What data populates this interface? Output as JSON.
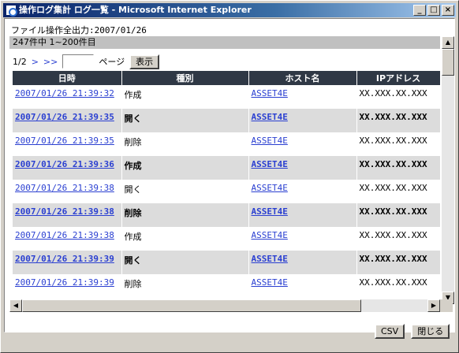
{
  "window": {
    "title": "操作ログ集計 ログ一覧 - Microsoft Internet Explorer",
    "buttons": [
      "_",
      "□",
      "×"
    ]
  },
  "header": {
    "text": "ファイル操作全出力:2007/01/26"
  },
  "count_bar": {
    "text": "247件中 1~200件目"
  },
  "pager": {
    "page": "1/2",
    "next": ">",
    "last": ">>",
    "page_input": "",
    "page_label": "ページ",
    "show_button": "表示"
  },
  "table": {
    "columns": [
      "日時",
      "種別",
      "ホスト名",
      "IPアドレス"
    ],
    "rows": [
      {
        "time": "2007/01/26 21:39:32",
        "type": "作成",
        "host": "ASSET4E",
        "ip": "XX.XXX.XX.XXX"
      },
      {
        "time": "2007/01/26 21:39:35",
        "type": "開く",
        "host": "ASSET4E",
        "ip": "XX.XXX.XX.XXX"
      },
      {
        "time": "2007/01/26 21:39:35",
        "type": "削除",
        "host": "ASSET4E",
        "ip": "XX.XXX.XX.XXX"
      },
      {
        "time": "2007/01/26 21:39:36",
        "type": "作成",
        "host": "ASSET4E",
        "ip": "XX.XXX.XX.XXX"
      },
      {
        "time": "2007/01/26 21:39:38",
        "type": "開く",
        "host": "ASSET4E",
        "ip": "XX.XXX.XX.XXX"
      },
      {
        "time": "2007/01/26 21:39:38",
        "type": "削除",
        "host": "ASSET4E",
        "ip": "XX.XXX.XX.XXX"
      },
      {
        "time": "2007/01/26 21:39:38",
        "type": "作成",
        "host": "ASSET4E",
        "ip": "XX.XXX.XX.XXX"
      },
      {
        "time": "2007/01/26 21:39:39",
        "type": "開く",
        "host": "ASSET4E",
        "ip": "XX.XXX.XX.XXX"
      },
      {
        "time": "2007/01/26 21:39:39",
        "type": "削除",
        "host": "ASSET4E",
        "ip": "XX.XXX.XX.XXX"
      }
    ]
  },
  "footer": {
    "csv_button": "CSV",
    "close_button": "閉じる"
  }
}
